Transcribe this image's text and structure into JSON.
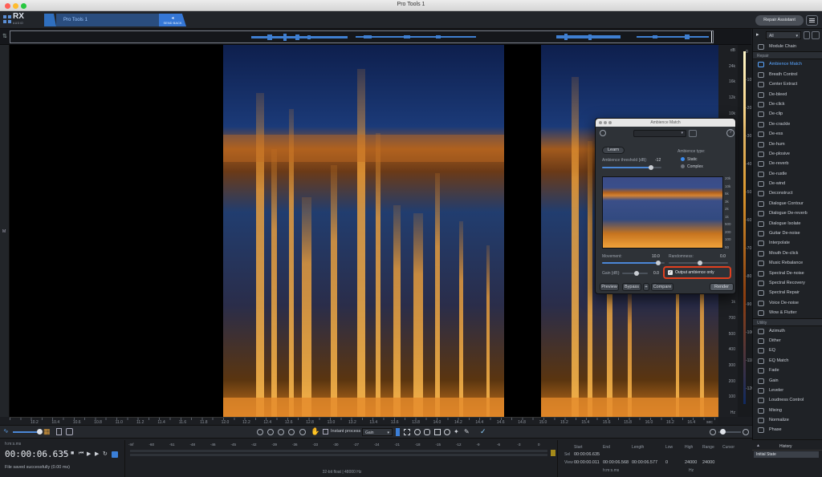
{
  "window": {
    "title": "Pro Tools 1"
  },
  "header": {
    "logo": "RX",
    "logo_sub": "AUDIO EDITOR",
    "file_tab": "Pro Tools 1",
    "send_back": "SEND BACK",
    "repair_assistant": "Repair Assistant"
  },
  "spectrogram": {
    "freq_labels": [
      "dB",
      "24k",
      "16k",
      "12k",
      "10k",
      "8k",
      "7k",
      "6k",
      "5k",
      "4.5k",
      "4k",
      "3.5k",
      "3k",
      "2.5k",
      "2k",
      "1.5k",
      "1k",
      "700",
      "500",
      "400",
      "300",
      "200",
      "100",
      "Hz"
    ],
    "db_labels": [
      "0",
      "-10",
      "-20",
      "-30",
      "-40",
      "-50",
      "-60",
      "-70",
      "-80",
      "-90",
      "-100",
      "-110",
      "-120"
    ]
  },
  "ruler": {
    "ticks": [
      "10.2",
      "10.4",
      "10.6",
      "10.8",
      "11.0",
      "11.2",
      "11.4",
      "11.6",
      "11.8",
      "12.0",
      "12.2",
      "12.4",
      "12.6",
      "12.8",
      "13.0",
      "13.2",
      "13.4",
      "13.6",
      "13.8",
      "14.0",
      "14.2",
      "14.4",
      "14.6",
      "14.8",
      "15.0",
      "15.2",
      "15.4",
      "15.6",
      "15.8",
      "16.0",
      "16.2",
      "16.4"
    ],
    "unit": "sec"
  },
  "toolbar": {
    "instant_process": "Instant process",
    "process_mode": "Gain"
  },
  "transport": {
    "time_format": "h:m:s.ms",
    "time": "00:00:06.635",
    "status": "File saved successfully (0.00 ms)",
    "meter_scale": [
      "-Inf",
      "-60",
      "-51",
      "-48",
      "-46",
      "-45",
      "-42",
      "-39",
      "-36",
      "-33",
      "-30",
      "-27",
      "-24",
      "-21",
      "-18",
      "-15",
      "-12",
      "-9",
      "-6",
      "-3",
      "0"
    ],
    "format": "32-bit float | 48000 Hz",
    "sel_headers": {
      "start": "Start",
      "end": "End",
      "length": "Length"
    },
    "sel_label": "Sel",
    "view_label": "View",
    "sel_start": "00:00:06.635",
    "view_start": "00:00:00.011",
    "view_end": "00:00:06.568",
    "view_length": "00:00:06.577",
    "sel_unit": "h:m:s.ms",
    "freq_headers": {
      "low": "Low",
      "high": "High",
      "range": "Range",
      "cursor": "Cursor"
    },
    "freq_low": "0",
    "freq_high": "24000",
    "freq_range": "24000",
    "freq_unit": "Hz"
  },
  "sidebar": {
    "filter": "All",
    "module_chain": "Module Chain",
    "repair_header": "Repair",
    "repair_items": [
      "Ambience Match",
      "Breath Control",
      "Center Extract",
      "De-bleed",
      "De-click",
      "De-clip",
      "De-crackle",
      "De-ess",
      "De-hum",
      "De-plosive",
      "De-reverb",
      "De-rustle",
      "De-wind",
      "Deconstruct",
      "Dialogue Contour",
      "Dialogue De-reverb",
      "Dialogue Isolate",
      "Guitar De-noise",
      "Interpolate",
      "Mouth De-click",
      "Music Rebalance",
      "Spectral De-noise",
      "Spectral Recovery",
      "Spectral Repair",
      "Voice De-noise",
      "Wow & Flutter"
    ],
    "utility_header": "Utility",
    "utility_items": [
      "Azimuth",
      "Dither",
      "EQ",
      "EQ Match",
      "Fade",
      "Gain",
      "Leveler",
      "Loudness Control",
      "Mixing",
      "Normalize",
      "Phase"
    ]
  },
  "history": {
    "title": "History",
    "items": [
      "Initial State"
    ]
  },
  "ambience_panel": {
    "title": "Ambience Match",
    "learn": "Learn",
    "threshold_label": "Ambience threshold [dB]:",
    "threshold_value": "-12",
    "threshold_level": 0.82,
    "type_label": "Ambience type:",
    "type_static": "Static",
    "type_complex": "Complex",
    "freq_labels": [
      "20k",
      "10k",
      "5k",
      "3k",
      "2k",
      "1k",
      "500",
      "200",
      "100",
      "50"
    ],
    "movement_label": "Movement:",
    "movement_value": "10.0",
    "movement_level": 0.9,
    "randomness_label": "Randomness:",
    "randomness_value": "0.0",
    "gain_label": "Gain [dB]:",
    "gain_value": "0.0",
    "output_only": "Output ambience only",
    "preview": "Preview",
    "bypass": "Bypass",
    "compare": "Compare",
    "render": "Render"
  }
}
